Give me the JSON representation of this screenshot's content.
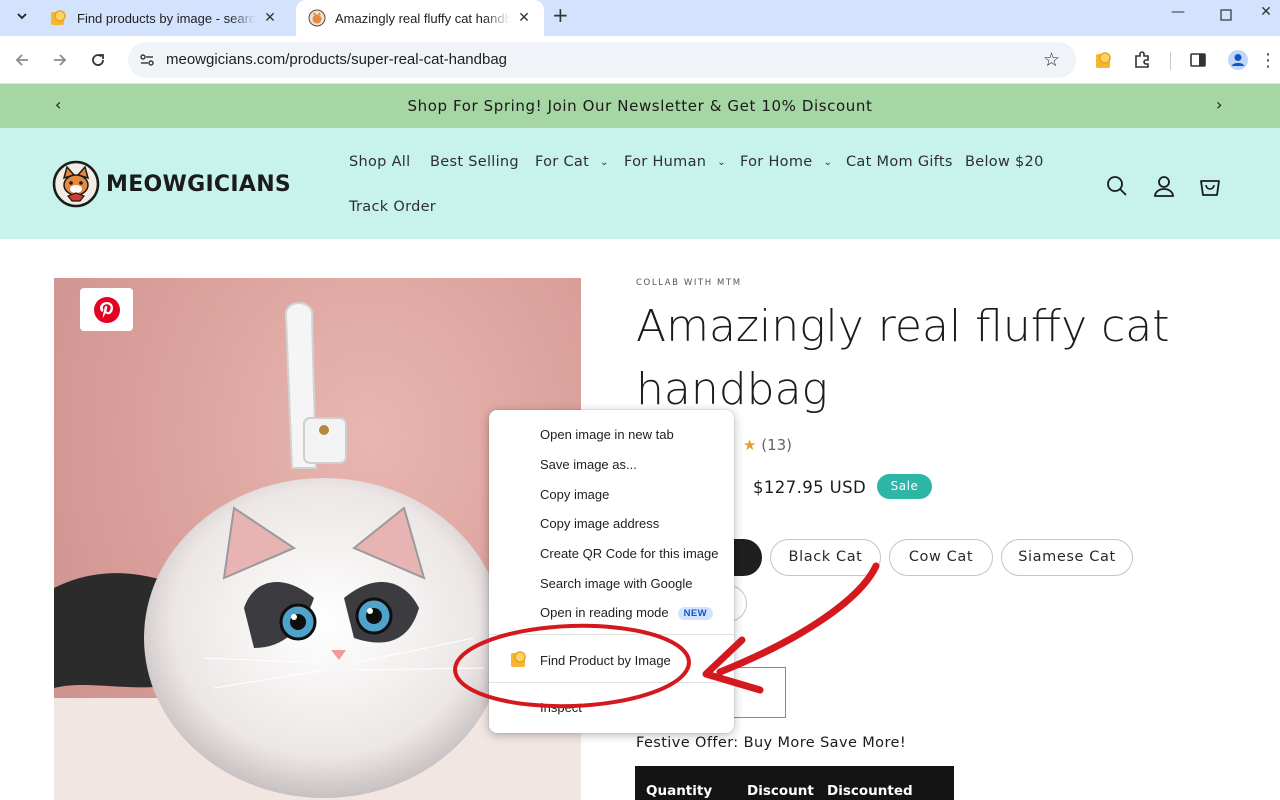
{
  "browser": {
    "tabs": [
      {
        "title": "Find products by image - search",
        "active": false
      },
      {
        "title": "Amazingly real fluffy cat handbag",
        "active": true
      }
    ],
    "url": "meowgicians.com/products/super-real-cat-handbag",
    "accent": "#d3e3fd"
  },
  "announcement": {
    "text": "Shop For Spring! Join Our Newsletter & Get 10% Discount",
    "background": "#a6d6a3"
  },
  "header": {
    "logo_text": "MEOWGICIANS",
    "background": "#c8f2ec",
    "nav": [
      {
        "label": "Shop All"
      },
      {
        "label": "Best Selling"
      },
      {
        "label": "For Cat"
      },
      {
        "label": "For Human"
      },
      {
        "label": "For Home"
      },
      {
        "label": "Cat Mom Gifts"
      },
      {
        "label": "Below $20"
      },
      {
        "label": "Track Order"
      }
    ]
  },
  "product": {
    "vendor": "COLLAB WITH MTM",
    "title": "Amazingly real fluffy cat handbag",
    "review_count": "(13)",
    "price": "$127.95 USD",
    "sale_badge": "Sale",
    "variants": [
      {
        "label": "Black Cat"
      },
      {
        "label": "Cow Cat"
      },
      {
        "label": "Siamese Cat"
      }
    ],
    "offer_heading": "Festive Offer: Buy More Save More!",
    "offer_columns": [
      "Quantity",
      "Discount",
      "Discounted price"
    ],
    "sale_color": "#2eb5a5"
  },
  "context_menu": {
    "items": [
      {
        "label": "Open image in new tab"
      },
      {
        "label": "Save image as..."
      },
      {
        "label": "Copy image"
      },
      {
        "label": "Copy image address"
      },
      {
        "label": "Create QR Code for this image"
      },
      {
        "label": "Search image with Google"
      },
      {
        "label": "Open in reading mode",
        "badge": "NEW"
      },
      {
        "label": "Find Product by Image",
        "icon": "extension-icon"
      },
      {
        "label": "Inspect"
      }
    ],
    "highlight_color": "#d4191e"
  }
}
